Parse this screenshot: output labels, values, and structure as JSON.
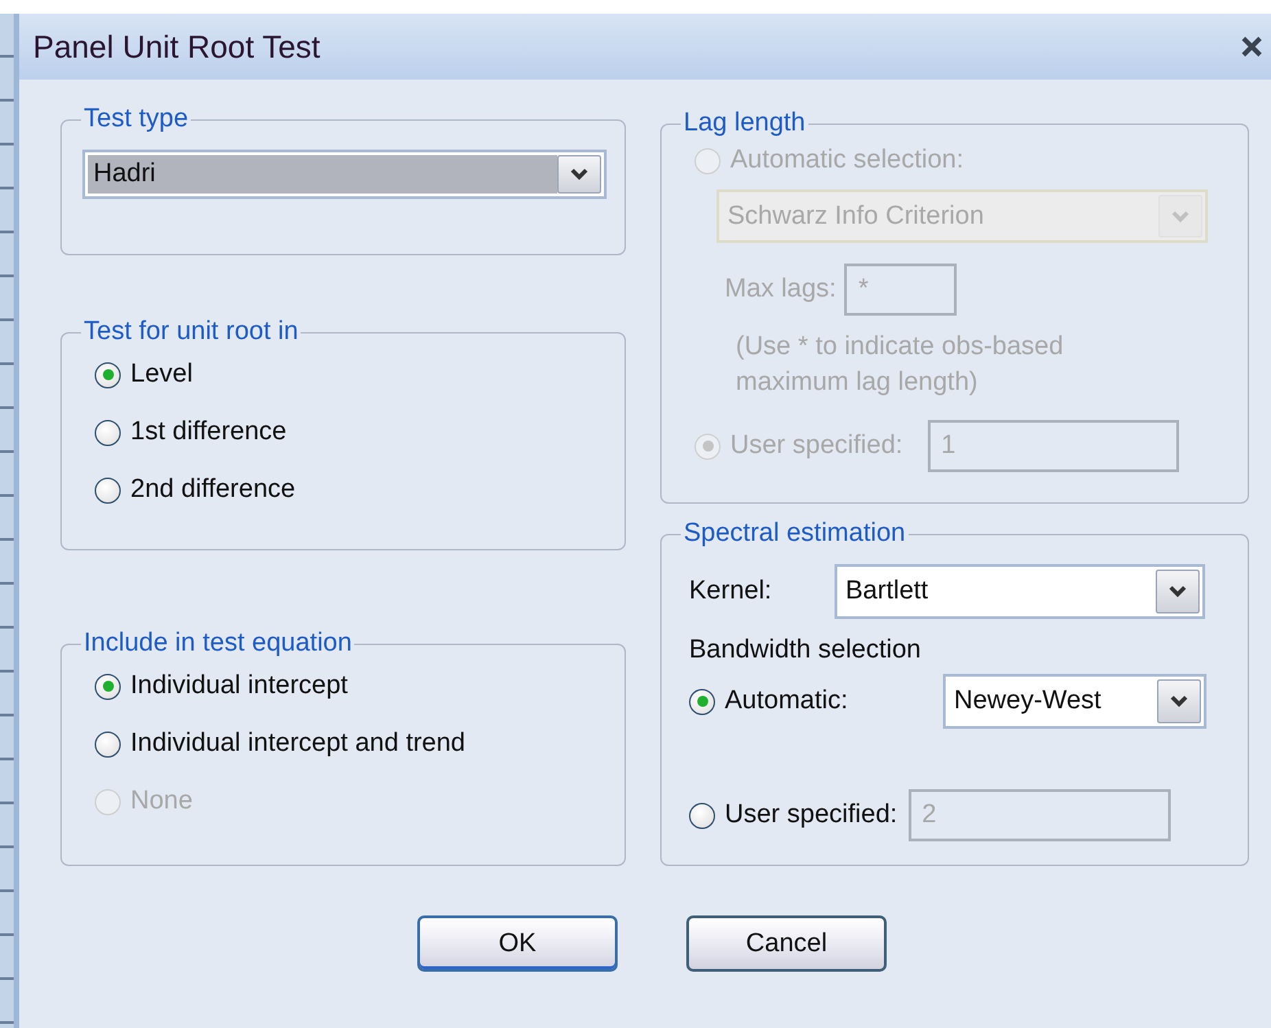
{
  "window": {
    "title": "Panel Unit Root Test"
  },
  "test_type": {
    "legend": "Test type",
    "value": "Hadri",
    "focused": true
  },
  "unit_root": {
    "legend": "Test for unit root in",
    "options": [
      {
        "label": "Level",
        "selected": true,
        "disabled": false
      },
      {
        "label": "1st difference",
        "selected": false,
        "disabled": false
      },
      {
        "label": "2nd difference",
        "selected": false,
        "disabled": false
      }
    ]
  },
  "include": {
    "legend": "Include in test equation",
    "options": [
      {
        "label": "Individual intercept",
        "selected": true,
        "disabled": false
      },
      {
        "label": "Individual intercept and trend",
        "selected": false,
        "disabled": false
      },
      {
        "label": "None",
        "selected": false,
        "disabled": true
      }
    ]
  },
  "lag_length": {
    "legend": "Lag length",
    "disabled": true,
    "automatic": {
      "label": "Automatic selection:",
      "selected": false
    },
    "criterion": "Schwarz Info Criterion",
    "max_lags": {
      "label": "Max lags:",
      "value": "*"
    },
    "note": "(Use * to indicate obs-based maximum lag length)",
    "user": {
      "label": "User specified:",
      "selected": true,
      "value": "1"
    }
  },
  "spectral": {
    "legend": "Spectral estimation",
    "kernel": {
      "label": "Kernel:",
      "value": "Bartlett"
    },
    "bandwidth_label": "Bandwidth selection",
    "automatic": {
      "label": "Automatic:",
      "selected": true,
      "value": "Newey-West"
    },
    "user": {
      "label": "User specified:",
      "selected": false,
      "value": "2",
      "disabled": true
    }
  },
  "buttons": [
    {
      "label": "OK",
      "default": true
    },
    {
      "label": "Cancel",
      "default": false
    }
  ]
}
